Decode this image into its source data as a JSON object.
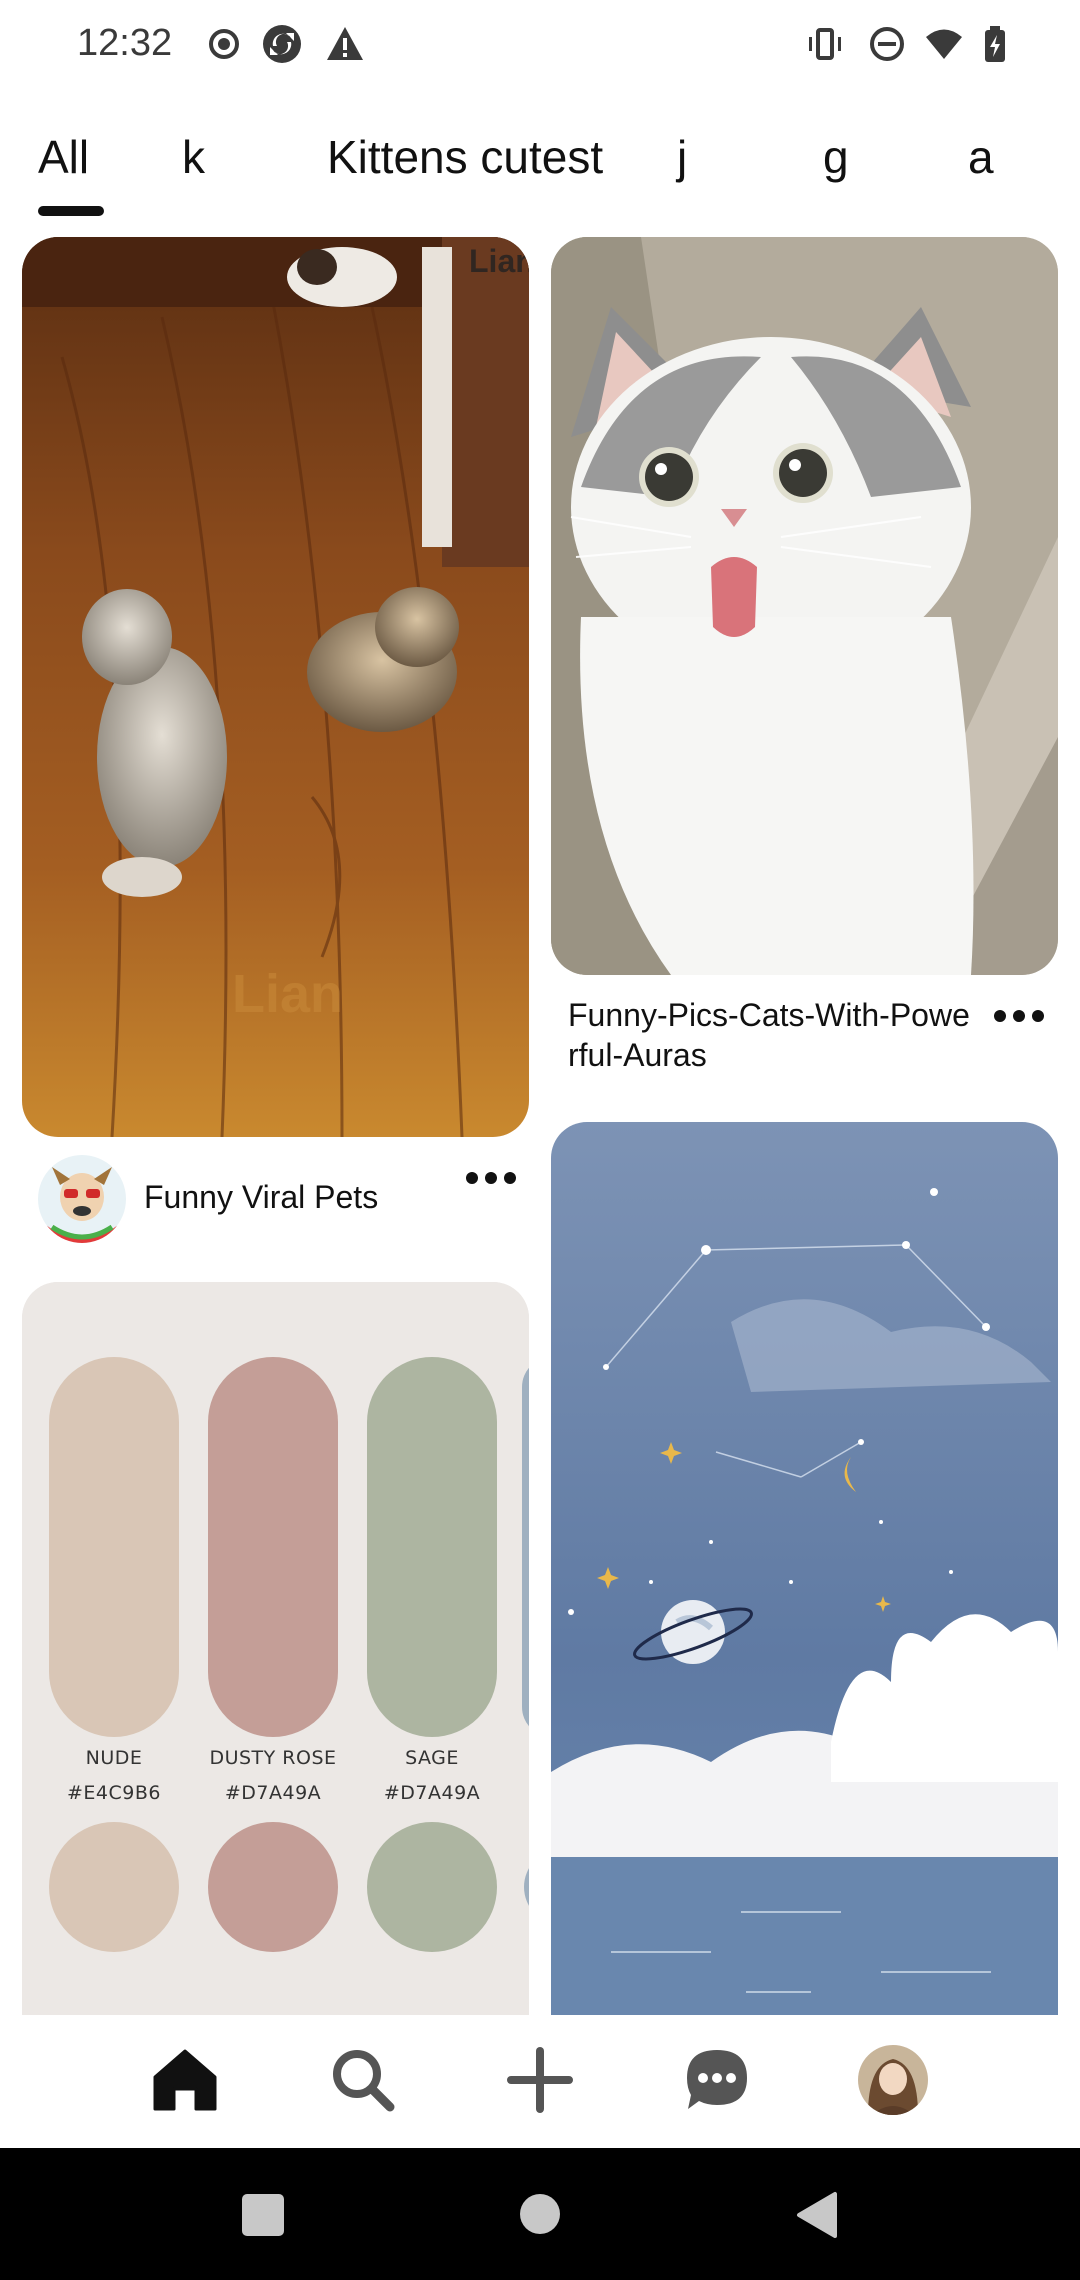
{
  "status_bar": {
    "time": "12:32",
    "left_icons": [
      "record-icon",
      "sync-icon",
      "alert-icon"
    ],
    "right_icons": [
      "vibrate-icon",
      "do-not-disturb-icon",
      "wifi-icon",
      "battery-icon"
    ]
  },
  "tabs": [
    {
      "label": "All",
      "selected": true
    },
    {
      "label": "k",
      "selected": false
    },
    {
      "label": "Kittens cutest",
      "selected": false
    },
    {
      "label": "j",
      "selected": false
    },
    {
      "label": "g",
      "selected": false
    },
    {
      "label": "a",
      "selected": false
    }
  ],
  "pins": {
    "kittens_video": {
      "watermark": "Lian",
      "creator_name": "Funny Viral Pets",
      "more_icon": "more-horizontal-icon"
    },
    "cat_face": {
      "title": "Funny-Pics-Cats-With-Powe rful-Auras",
      "more_icon": "more-horizontal-icon"
    },
    "palette": {
      "swatches": [
        {
          "name": "NUDE",
          "hex": "#E4C9B6",
          "color": "#D9C6B6"
        },
        {
          "name": "DUSTY ROSE",
          "hex": "#D7A49A",
          "color": "#C49E97"
        },
        {
          "name": "SAGE",
          "hex": "#D7A49A",
          "color": "#ADB5A1"
        }
      ]
    },
    "night_sky": {}
  },
  "bottom_nav": [
    {
      "icon": "home-icon",
      "active": true
    },
    {
      "icon": "search-icon",
      "active": false
    },
    {
      "icon": "add-icon",
      "active": false
    },
    {
      "icon": "messages-icon",
      "active": false
    },
    {
      "icon": "profile-avatar",
      "active": false
    }
  ],
  "system_nav": [
    "recents-button",
    "home-button",
    "back-button"
  ],
  "colors": {
    "text": "#111111",
    "palette_card_bg": "#ECE8E5",
    "sky_blue": "#6F86A8"
  }
}
